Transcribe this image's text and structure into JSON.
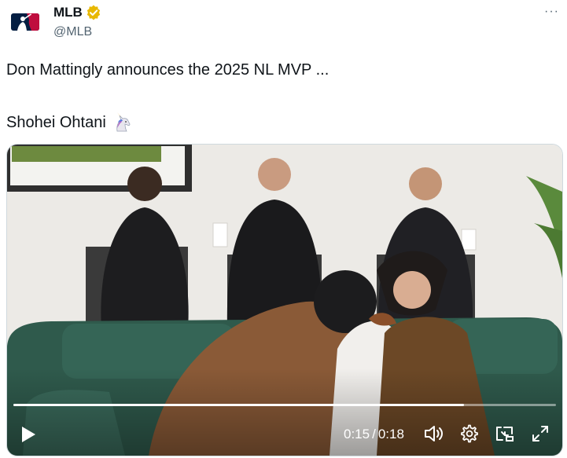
{
  "author": {
    "display_name": "MLB",
    "handle": "@MLB",
    "verified_badge_color": "#e8b800"
  },
  "menu": {
    "label": "···"
  },
  "tweet": {
    "line1": "Don Mattingly announces the 2025 NL MVP ...",
    "line2": "Shohei Ohtani",
    "emoji": "unicorn-icon"
  },
  "video": {
    "current_time": "0:15",
    "separator": "/",
    "duration": "0:18",
    "progress_fraction": 0.83
  },
  "colors": {
    "text": "#0f1419",
    "muted": "#536471",
    "mlb_blue": "#041e42",
    "mlb_red": "#bf0d3e"
  }
}
